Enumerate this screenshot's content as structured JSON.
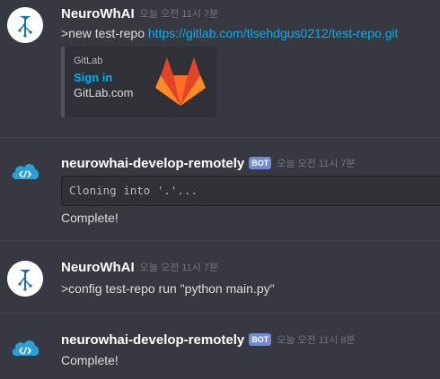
{
  "messages": [
    {
      "username": "NeuroWhAI",
      "timestamp": "오늘 오전 11시 7분",
      "content_prefix": ">new test-repo ",
      "content_link": "https://gitlab.com/tlsehdgus0212/test-repo.git",
      "embed": {
        "provider": "GitLab",
        "title": "Sign in",
        "description": "GitLab.com"
      }
    },
    {
      "username": "neurowhai-develop-remotely",
      "bot_tag": "BOT",
      "timestamp": "오늘 오전 11시 7분",
      "code": "Cloning into '.'...",
      "content": "Complete!"
    },
    {
      "username": "NeuroWhAI",
      "timestamp": "오늘 오전 11시 7분",
      "content": ">config test-repo run \"python main.py\""
    },
    {
      "username": "neurowhai-develop-remotely",
      "bot_tag": "BOT",
      "timestamp": "오늘 오전 11시 8분",
      "content": "Complete!"
    }
  ],
  "colors": {
    "background": "#36393f",
    "link": "#00b0f4",
    "bot_tag": "#7289da",
    "cloud_icon": "#2b9fd9",
    "gitlab_orange": "#fc6d26"
  },
  "icons": {
    "avatar_user": "neurowhai-logo-icon",
    "avatar_bot": "cloud-code-icon",
    "embed_thumbnail": "gitlab-logo-icon"
  }
}
